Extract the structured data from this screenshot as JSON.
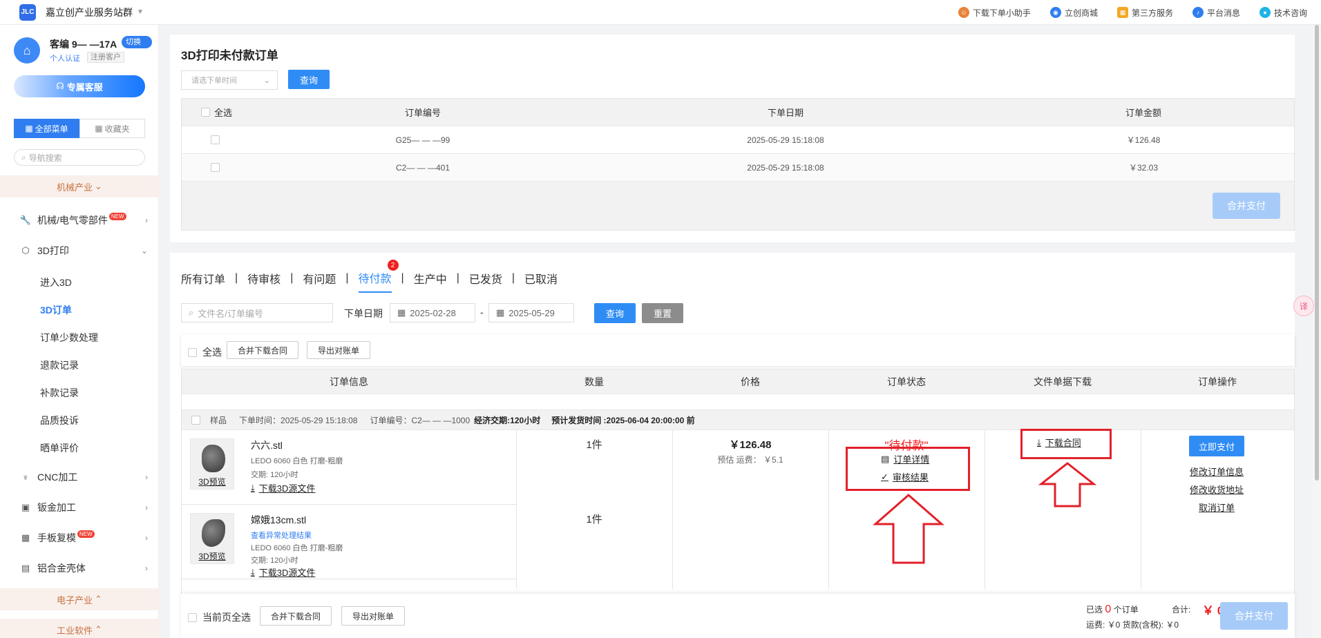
{
  "topbar": {
    "logo": "JLC",
    "site_name": "嘉立创产业服务站群",
    "links": [
      {
        "label": "下载下单小助手",
        "icon": "assistant-icon",
        "color": "#e8833a"
      },
      {
        "label": "立创商城",
        "icon": "mall-icon",
        "color": "#2f7df0"
      },
      {
        "label": "第三方服务",
        "icon": "grid-icon",
        "color": "#f5a623"
      },
      {
        "label": "平台消息",
        "icon": "bell-icon",
        "color": "#2f7df0"
      },
      {
        "label": "技术咨询",
        "icon": "chat-icon",
        "color": "#1db3e6"
      }
    ]
  },
  "sidebar": {
    "customer_id": "客编 9—  —17A",
    "switch_label": "切换 ⇄",
    "verify_label": "个人认证",
    "reg_label": "注册客户",
    "service_label": "专属客服",
    "tab_all": "全部菜单",
    "tab_fav": "收藏夹",
    "search_placeholder": "导航搜索",
    "sec_mech": "机械产业",
    "items": [
      {
        "label": "机械/电气零部件",
        "new": "NEW"
      },
      {
        "label": "3D打印"
      },
      {
        "label": "CNC加工"
      },
      {
        "label": "钣金加工"
      },
      {
        "label": "手板复模",
        "new": "NEW"
      },
      {
        "label": "铝合金壳体"
      }
    ],
    "sub_items": [
      "进入3D",
      "3D订单",
      "订单少数处理",
      "退款记录",
      "补款记录",
      "品质投诉",
      "晒单评价"
    ],
    "sec_elec": "电子产业",
    "sec_soft": "工业软件"
  },
  "unpaid": {
    "title": "3D打印未付款订单",
    "date_placeholder": "请选下单时间",
    "query_label": "查询",
    "headers": {
      "select_all": "全选",
      "order_no": "订单编号",
      "date": "下单日期",
      "amount": "订单金额"
    },
    "rows": [
      {
        "order_no": "G25—  —  —99",
        "date": "2025-05-29 15:18:08",
        "amount": "￥126.48"
      },
      {
        "order_no": "C2—   —  —401",
        "date": "2025-05-29 15:18:08",
        "amount": "￥32.03"
      }
    ],
    "merge_pay": "合并支付"
  },
  "orders": {
    "tabs": [
      {
        "label": "所有订单"
      },
      {
        "label": "待审核"
      },
      {
        "label": "有问题"
      },
      {
        "label": "待付款",
        "badge": "2"
      },
      {
        "label": "生产中"
      },
      {
        "label": "已发货"
      },
      {
        "label": "已取消"
      }
    ],
    "search_placeholder": "文件名/订单编号",
    "date_label": "下单日期",
    "date_from": "2025-02-28",
    "date_to": "2025-05-29",
    "date_sep": "-",
    "query_label": "查询",
    "reset_label": "重置",
    "select_all": "全选",
    "merge_contract": "合并下载合同",
    "export_bill": "导出对账单",
    "headers": [
      "订单信息",
      "数量",
      "价格",
      "订单状态",
      "文件单据下载",
      "订单操作"
    ],
    "meta": {
      "sample": "样品",
      "time": "下单时间：2025-05-29 15:18:08",
      "order_no": "订单编号：C2—   —  —1000",
      "lead": "经济交期:120小时",
      "ship_time": "预计发货时间 :2025-06-04 20:00:00 前"
    },
    "items": [
      {
        "name": "六六.stl",
        "spec": "LEDO 6060  白色 打磨-粗磨",
        "lead": "交期: 120小时",
        "download": "下载3D源文件",
        "preview": "3D预览",
        "qty": "1件"
      },
      {
        "name": "嫦娥13cm.stl",
        "abnormal": "查看异常处理结果",
        "spec": "LEDO 6060  白色 打磨-粗磨",
        "lead": "交期: 120小时",
        "download": "下载3D源文件",
        "preview": "3D预览",
        "qty": "1件"
      }
    ],
    "price": "￥126.48",
    "ship_fee": "预估 运费：  ￥5.1",
    "status": "\"待付款\"",
    "detail_link": "订单详情",
    "review_link": "审核结果",
    "contract_link": "下载合同",
    "pay_now": "立即支付",
    "modify_info": "修改订单信息",
    "modify_addr": "修改收货地址",
    "cancel": "取消订单"
  },
  "footer": {
    "page_select_all": "当前页全选",
    "merge_contract": "合并下载合同",
    "export_bill": "导出对账单",
    "selected_prefix": "已选",
    "selected_count": "0",
    "selected_suffix": "个订单",
    "fees": "运费: ￥0    货款(含税): ￥0",
    "total_label": "合计:",
    "total_value": "￥ 0",
    "merge_pay": "合并支付"
  },
  "float_translate": "译",
  "colors": {
    "primary": "#2f8cf5",
    "accent_red": "#f02020",
    "highlight_box": "#e2202a",
    "section_orange": "#c7703d"
  }
}
